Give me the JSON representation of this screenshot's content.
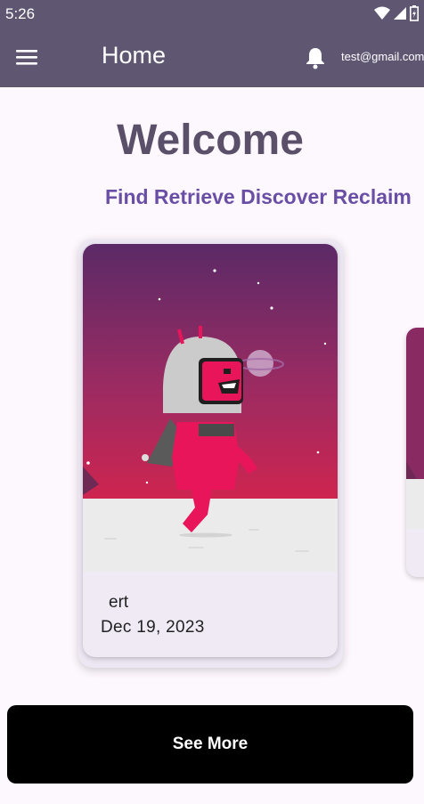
{
  "status_bar": {
    "time": "5:26",
    "icons": [
      "wifi-icon",
      "signal-icon",
      "battery-icon"
    ]
  },
  "app_bar": {
    "title": "Home",
    "user_email": "test@gmail.com",
    "icons": [
      "menu-icon",
      "bell-icon"
    ],
    "background": "#5f5672"
  },
  "main": {
    "heading": "Welcome",
    "tagline": "Find Retrieve Discover Reclaim"
  },
  "carousel": {
    "items": [
      {
        "name": "ert",
        "date": "Dec 19, 2023",
        "image": "astronaut-robot-illustration"
      }
    ]
  },
  "actions": {
    "see_more_label": "See More"
  },
  "colors": {
    "heading": "#5a5069",
    "tagline": "#6a4ea5",
    "button": "#000000"
  }
}
